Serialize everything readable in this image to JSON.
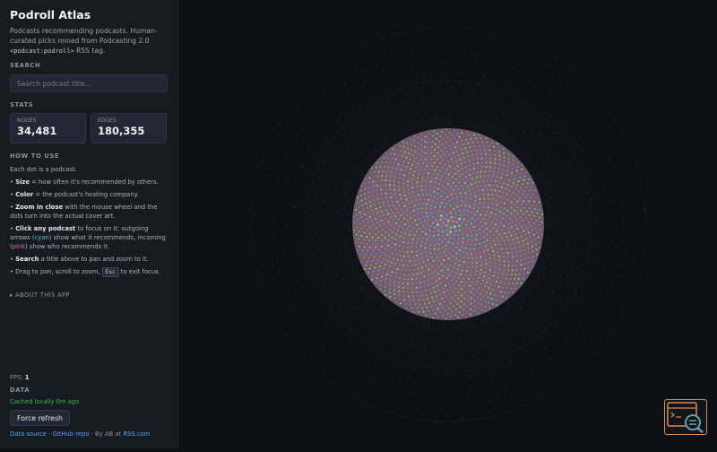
{
  "app": {
    "title": "Podroll Atlas",
    "description_1": "Podcasts recommending podcasts. Human-curated picks mined from Podcasting 2.0",
    "description_tag": "<podcast:podroll>",
    "description_2": " RSS tag."
  },
  "search": {
    "heading": "SEARCH",
    "placeholder": "Search podcast title..."
  },
  "stats": {
    "heading": "STATS",
    "nodes_label": "NODES",
    "nodes_value": "34,481",
    "edges_label": "EDGES",
    "edges_value": "180,355"
  },
  "howto": {
    "heading": "HOW TO USE",
    "intro": "Each dot is a podcast.",
    "size_bullet": "•",
    "size_bold": "Size",
    "size_text": " = how often it's recommended by others.",
    "color_bullet": "•",
    "color_bold": "Color",
    "color_text": " = the podcast's hosting company.",
    "zoom_bullet": "•",
    "zoom_bold": "Zoom in close",
    "zoom_text": " with the mouse wheel and the dots turn into the actual cover art.",
    "click_bullet": "•",
    "click_bold": "Click any podcast",
    "click_text_1": " to focus on it: outgoing arrows (",
    "click_cyan": "cyan",
    "click_text_2": ") show what it recommends, incoming (",
    "click_pink": "pink",
    "click_text_3": ") show who recommends it.",
    "search_bullet": "•",
    "search_bold": "Search",
    "search_text": " a title above to pan and zoom to it.",
    "drag_text_1": "• Drag to pan, scroll to zoom,",
    "drag_key": "Esc",
    "drag_text_2": "to exit focus."
  },
  "about": {
    "label": "▸ ABOUT THIS APP"
  },
  "fps": {
    "label": "FPS:",
    "value": "1"
  },
  "data_section": {
    "heading": "DATA",
    "cached": "Cached locally 0m ago",
    "force_label": "Force refresh"
  },
  "footer": {
    "data_source": "Data source",
    "sep": "·",
    "github": "GitHub repo",
    "by": "By AB at",
    "rss": "RSS.com"
  },
  "colors": {
    "accent_cyan": "#48c6d8",
    "accent_pink": "#e46bb1",
    "cached_green": "#3fb950",
    "link_blue": "#58a6ff",
    "logo_orange": "#d98a4e"
  },
  "icons": {
    "logo": "terminal-magnifier-logo-icon"
  }
}
